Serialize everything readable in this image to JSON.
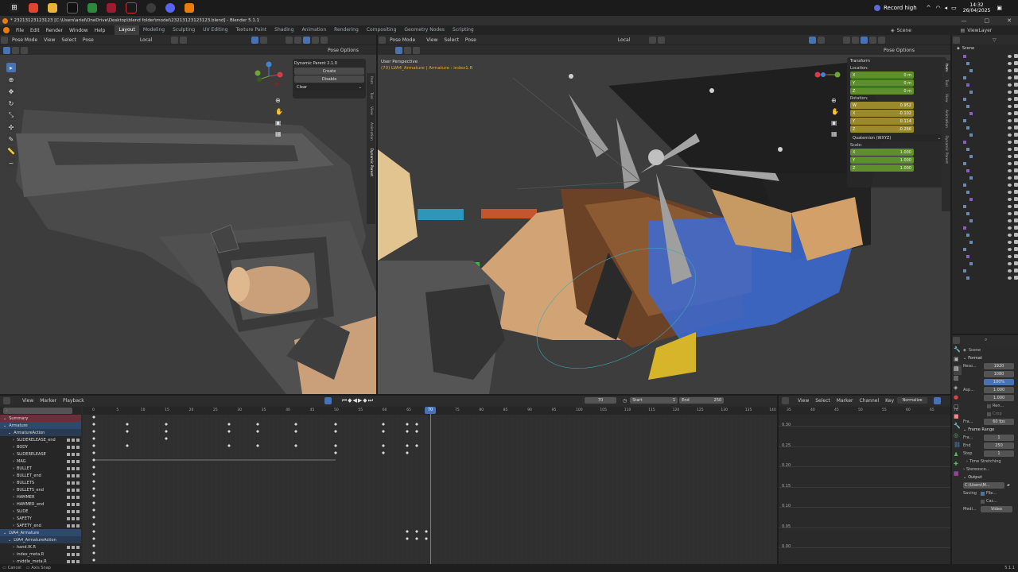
{
  "taskbar": {
    "record_label": "Record high",
    "time": "14:32",
    "date": "26/04/2025"
  },
  "titlebar": {
    "title": "* 23213123123123 [C:\\Users\\ariel\\OneDrive\\Desktop\\blend folder\\model\\23213123123123.blend] - Blender 5.1.1"
  },
  "menubar": {
    "menus": [
      "File",
      "Edit",
      "Render",
      "Window",
      "Help"
    ],
    "workspaces": [
      "Layout",
      "Modeling",
      "Sculpting",
      "UV Editing",
      "Texture Paint",
      "Shading",
      "Animation",
      "Rendering",
      "Compositing",
      "Geometry Nodes",
      "Scripting"
    ],
    "scene": "Scene",
    "view_layer": "ViewLayer"
  },
  "left_viewport": {
    "mode": "Pose Mode",
    "menus": [
      "View",
      "Select",
      "Pose"
    ],
    "orientation": "Local",
    "pose_options": "Pose Options",
    "addon_panel": {
      "title": "Dynamic Parent 2.1.0",
      "create": "Create",
      "disable": "Disable",
      "clear": "Clear"
    },
    "side_tabs": [
      "Item",
      "Tool",
      "View",
      "Animation",
      "Dynamic Parent"
    ]
  },
  "right_viewport": {
    "mode": "Pose Mode",
    "menus": [
      "View",
      "Select",
      "Pose"
    ],
    "orientation": "Local",
    "pose_options": "Pose Options",
    "perspective": "User Perspective",
    "object_info": "(70) LVA4_Armature | Armature : index1.R",
    "transform": {
      "title": "Transform",
      "location_label": "Location:",
      "location": [
        {
          "axis": "X",
          "value": "0 m"
        },
        {
          "axis": "Y",
          "value": "0 m"
        },
        {
          "axis": "Z",
          "value": "0 m"
        }
      ],
      "rotation_label": "Rotation:",
      "rotation": [
        {
          "axis": "W",
          "value": "0.952"
        },
        {
          "axis": "X",
          "value": "-0.102"
        },
        {
          "axis": "Y",
          "value": "0.114"
        },
        {
          "axis": "Z",
          "value": "-0.266"
        }
      ],
      "rotation_mode": "Quaternion (WXYZ)",
      "scale_label": "Scale:",
      "scale": [
        {
          "axis": "X",
          "value": "1.000"
        },
        {
          "axis": "Y",
          "value": "1.000"
        },
        {
          "axis": "Z",
          "value": "1.000"
        }
      ]
    },
    "side_tabs": [
      "Item",
      "Tool",
      "View",
      "Animation",
      "Dynamic Parent"
    ]
  },
  "outliner": {
    "title": "Scene"
  },
  "timeline": {
    "menus": [
      "View",
      "Marker",
      "Playback"
    ],
    "current_frame": "70",
    "start_label": "Start",
    "start": "1",
    "end_label": "End",
    "end": "250",
    "ruler": [
      "0",
      "5",
      "10",
      "15",
      "20",
      "25",
      "30",
      "35",
      "40",
      "45",
      "50",
      "55",
      "60",
      "65",
      "70",
      "75",
      "80",
      "85",
      "90",
      "95",
      "100",
      "105",
      "110",
      "115",
      "120",
      "125",
      "130",
      "135",
      "140"
    ],
    "channels": [
      {
        "name": "Summary",
        "level": 0,
        "style": "summary"
      },
      {
        "name": "Armature",
        "level": 0,
        "style": "object"
      },
      {
        "name": "ArmatureAction",
        "level": 1,
        "style": "action"
      },
      {
        "name": "SLIDERELEASE_end",
        "level": 2,
        "style": "group"
      },
      {
        "name": "BODY",
        "level": 2,
        "style": "group"
      },
      {
        "name": "SLIDERELEASE",
        "level": 2,
        "style": "group"
      },
      {
        "name": "MAG",
        "level": 2,
        "style": "group"
      },
      {
        "name": "BULLET",
        "level": 2,
        "style": "group"
      },
      {
        "name": "BULLET_end",
        "level": 2,
        "style": "group"
      },
      {
        "name": "BULLETS",
        "level": 2,
        "style": "group"
      },
      {
        "name": "BULLETS_end",
        "level": 2,
        "style": "group"
      },
      {
        "name": "HAMMER",
        "level": 2,
        "style": "group"
      },
      {
        "name": "HAMMER_end",
        "level": 2,
        "style": "group"
      },
      {
        "name": "SLIDE",
        "level": 2,
        "style": "group"
      },
      {
        "name": "SAFETY",
        "level": 2,
        "style": "group"
      },
      {
        "name": "SAFETY_end",
        "level": 2,
        "style": "group"
      },
      {
        "name": "LVA4_Armature",
        "level": 0,
        "style": "object"
      },
      {
        "name": "LVA4_ArmatureAction",
        "level": 1,
        "style": "action"
      },
      {
        "name": "hand.IK.R",
        "level": 2,
        "style": "group"
      },
      {
        "name": "index_meta.R",
        "level": 2,
        "style": "group"
      },
      {
        "name": "middle_meta.R",
        "level": 2,
        "style": "group"
      }
    ]
  },
  "graph_editor": {
    "menus": [
      "View",
      "Select",
      "Marker",
      "Channel",
      "Key"
    ],
    "normalize": "Normalize",
    "ruler": [
      "35",
      "40",
      "45",
      "50",
      "55",
      "60",
      "65",
      "70"
    ],
    "y_ticks": [
      "0.30",
      "0.25",
      "0.20",
      "0.15",
      "0.10",
      "0.05",
      "0.00"
    ]
  },
  "properties": {
    "scene": "Scene",
    "format_title": "Format",
    "resolution_label": "Reso...",
    "res_x": "1920",
    "res_y": "1080",
    "res_pct": "100%",
    "aspect_label": "Asp...",
    "aspect_x": "1.000",
    "aspect_y": "1.000",
    "render_region": "Ren...",
    "crop": "Crop",
    "fps_label": "Fra...",
    "fps": "60 fps",
    "frame_range_title": "Frame Range",
    "frame_start_label": "Fra...",
    "frame_start": "1",
    "frame_end_label": "End",
    "frame_end": "250",
    "step_label": "Step",
    "step": "1",
    "time_stretching": "Time Stretching",
    "stereoscopy": "Stereosco...",
    "output_title": "Output",
    "output_path": "C:\\Users\\M...",
    "saving_label": "Saving",
    "file_ext": "File...",
    "cache": "Cac...",
    "media_label": "Medi...",
    "media": "Video"
  },
  "statusbar": {
    "left": "Cancel",
    "middle": "Axis Snap",
    "version": "5.1.1"
  }
}
